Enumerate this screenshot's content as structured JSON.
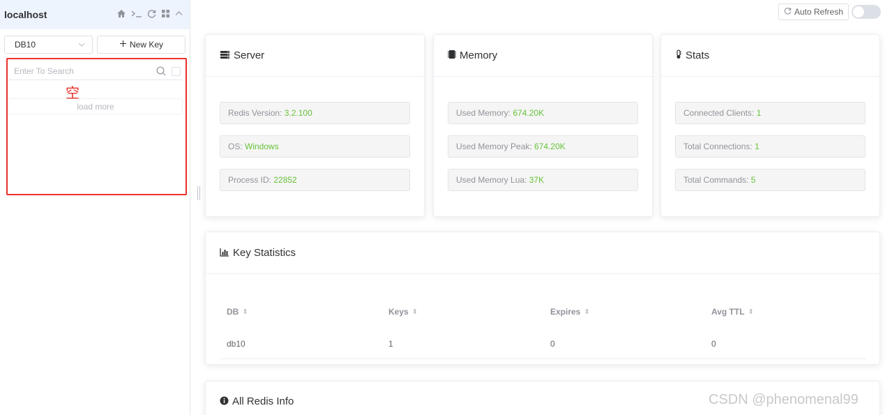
{
  "sidebar": {
    "connection_name": "localhost",
    "db_selected": "DB10",
    "new_key_label": "New Key",
    "search_placeholder": "Enter To Search",
    "empty_mark": "空",
    "load_more_label": "load more"
  },
  "topbar": {
    "auto_refresh_label": "Auto Refresh"
  },
  "server": {
    "title": "Server",
    "rows": [
      {
        "label": "Redis Version:",
        "value": "3.2.100"
      },
      {
        "label": "OS:",
        "value": "Windows"
      },
      {
        "label": "Process ID:",
        "value": "22852"
      }
    ]
  },
  "memory": {
    "title": "Memory",
    "rows": [
      {
        "label": "Used Memory:",
        "value": "674.20K"
      },
      {
        "label": "Used Memory Peak:",
        "value": "674.20K"
      },
      {
        "label": "Used Memory Lua:",
        "value": "37K"
      }
    ]
  },
  "stats": {
    "title": "Stats",
    "rows": [
      {
        "label": "Connected Clients:",
        "value": "1"
      },
      {
        "label": "Total Connections:",
        "value": "1"
      },
      {
        "label": "Total Commands:",
        "value": "5"
      }
    ]
  },
  "key_statistics": {
    "title": "Key Statistics",
    "columns": [
      "DB",
      "Keys",
      "Expires",
      "Avg TTL"
    ],
    "rows": [
      [
        "db10",
        "1",
        "0",
        "0"
      ]
    ]
  },
  "all_info": {
    "title": "All Redis Info"
  },
  "watermark": "CSDN @phenomenal99",
  "colors": {
    "accent_green": "#67c23a",
    "annotation_red": "#e8322b",
    "header_bg": "#eef4fd"
  },
  "icons": [
    "home-icon",
    "terminal-icon",
    "refresh-icon",
    "grid-icon",
    "chevron-up-icon",
    "chevron-down-icon",
    "plus-icon",
    "search-icon",
    "server-icon",
    "memory-icon",
    "thermometer-icon",
    "bar-chart-icon",
    "info-icon"
  ]
}
